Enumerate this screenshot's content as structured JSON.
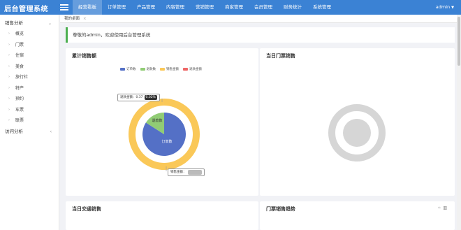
{
  "app": {
    "title": "后台管理系统"
  },
  "nav": {
    "items": [
      "经营看板",
      "订单管理",
      "产品管理",
      "内容管理",
      "营销管理",
      "商家管理",
      "会员管理",
      "财务统计",
      "系统管理"
    ],
    "active_index": 0
  },
  "user": {
    "name": "admin"
  },
  "sidebar": {
    "group1": {
      "label": "销售分析",
      "items": [
        "概览",
        "门票",
        "住宿",
        "美食",
        "旅行社",
        "特产",
        "预约",
        "车票",
        "联票"
      ]
    },
    "group2": {
      "label": "访问分析"
    }
  },
  "tabs": [
    {
      "label": "我的桌面"
    }
  ],
  "welcome": {
    "text": "尊敬的admin，欢迎使用后台管理系统"
  },
  "cards": {
    "sales_total": {
      "title": "累计销售额"
    },
    "ticket_today": {
      "title": "当日门票销售"
    },
    "transport_today": {
      "title": "当日交通销售"
    },
    "ticket_trend": {
      "title": "门票销售趋势"
    }
  },
  "chart_data": {
    "type": "pie",
    "legend": [
      "订单数",
      "退款数",
      "销售金额",
      "退款金额"
    ],
    "colors": {
      "订单数": "#5470c6",
      "退款数": "#91cc75",
      "销售金额": "#fac858",
      "退款金额": "#ee6666"
    },
    "inner": {
      "labels": [
        "订单数",
        "退款数"
      ],
      "values": [
        84,
        16
      ]
    },
    "outer": {
      "labels": [
        "销售金额",
        "退款金额"
      ],
      "values": [
        99.98,
        0.02
      ]
    },
    "tooltips": {
      "refund": {
        "label": "退款金额：",
        "value": "0.37",
        "percent": "0.02%"
      },
      "sales": {
        "label": "销售金额："
      }
    }
  }
}
